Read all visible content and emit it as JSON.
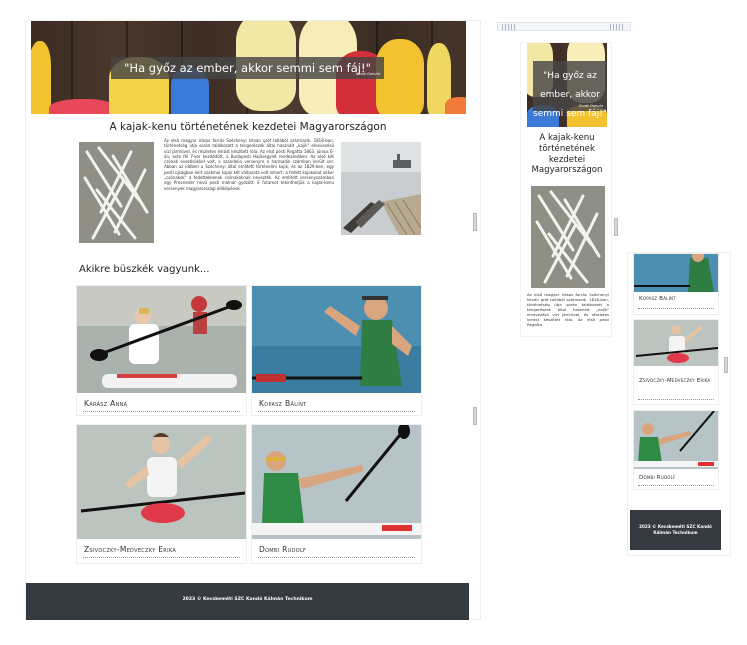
{
  "quote": {
    "text": "\"Ha győz az ember, akkor semmi sem fáj!\"",
    "author": "Kozák Danuta"
  },
  "article": {
    "title": "A kajak-kenu történetének kezdetei Magyarországon",
    "body": "Az első magyar írásos forrás Széchenyi István gróf tollából származik. 1818-ban, történetség útja során találkozott a tengerészek által használt „kajik\" elnevezésű vízi járművel, és részletes leírást készített róla. Az első pesti Regatta 1863. június 6-án, este fél 7-kor kezdődött, a Budapesti Hajósegylet rendezésében. Az első két csónak evezősökkel volt, a szandolin versenyre a harmadik számban került sor. Abban az időben a Széchenyi által említett történelmi kajik, és az 1829-ben, egy pesti újságban leírt szakmai kajak két változata volt ismert: a fedett kajakokat akkor „csónakok\" a fedettekkenek csónakoknak nevezték. Az említett versenyszámban egy Pressleder nevű pesti molnár győzött. E futamot tekinthetjük a kajak-kenu versenyek magyarországi előképének.",
    "mobile_excerpt": "Az első magyar írásos forrás Széchenyi István gróf tollából származik. 1818-ban, történetség útja során találkozott a tengerészek által használt „kajik\" elnevezésű vízi járművel, és részletes leírást készített róla. Az első pesti Regatta"
  },
  "athletes_heading": "Akikre büszkék vagyunk...",
  "athletes": [
    {
      "name": "Kárász Anna"
    },
    {
      "name": "Kopasz Bálint"
    },
    {
      "name": "Zsivoczky-Medveczky Erika"
    },
    {
      "name": "Dombi Rudolf"
    }
  ],
  "footer": {
    "text": "2023 © Kecskeméti SZC Kandó Kálmán Technikum"
  },
  "colors": {
    "footer_bg": "#343a40",
    "quote_bg": "#464646",
    "paddle_yellow": "#f2c230",
    "paddle_red": "#d93a3a",
    "paddle_orange": "#f07a3a",
    "wood": "#3d2d24"
  }
}
